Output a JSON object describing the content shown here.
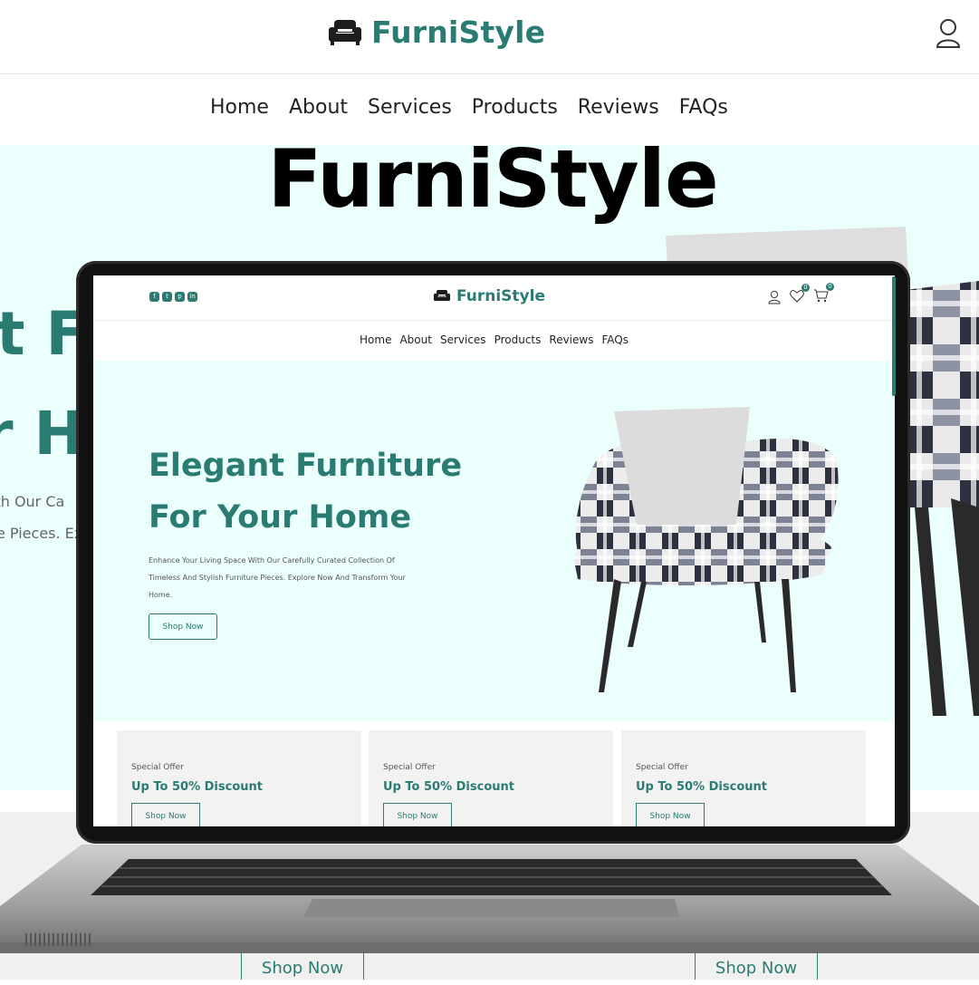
{
  "brand": {
    "name": "FurniStyle",
    "accent": "#2a7b72",
    "hero_bg": "#ebfffc"
  },
  "background_site": {
    "nav": [
      "Home",
      "About",
      "Services",
      "Products",
      "Reviews",
      "FAQs"
    ],
    "hero_fragment_1": "t Fu",
    "hero_fragment_2": "r H",
    "sub_fragment_1": "ith Our Ca",
    "sub_fragment_2": "e Pieces. Ex",
    "shop_button": "Shop Now"
  },
  "overlay_title": "FurniStyle",
  "screen": {
    "social_icons": [
      "facebook-icon",
      "twitter-icon",
      "pinterest-icon",
      "linkedin-icon"
    ],
    "header_icons": {
      "user": "user-icon",
      "wishlist": "heart-icon",
      "cart": "cart-icon"
    },
    "wishlist_count": "0",
    "cart_count": "0",
    "nav": [
      "Home",
      "About",
      "Services",
      "Products",
      "Reviews",
      "FAQs"
    ],
    "hero": {
      "title_line1": "Elegant Furniture",
      "title_line2": "For Your Home",
      "description": "Enhance Your Living Space With Our Carefully Curated Collection Of Timeless And Stylish Furniture Pieces. Explore Now And Transform Your Home.",
      "button": "Shop Now"
    },
    "offers": [
      {
        "label": "Special Offer",
        "title": "Up To 50% Discount",
        "button": "Shop Now"
      },
      {
        "label": "Special Offer",
        "title": "Up To 50% Discount",
        "button": "Shop Now"
      },
      {
        "label": "Special Offer",
        "title": "Up To 50% Discount",
        "button": "Shop Now"
      }
    ]
  }
}
